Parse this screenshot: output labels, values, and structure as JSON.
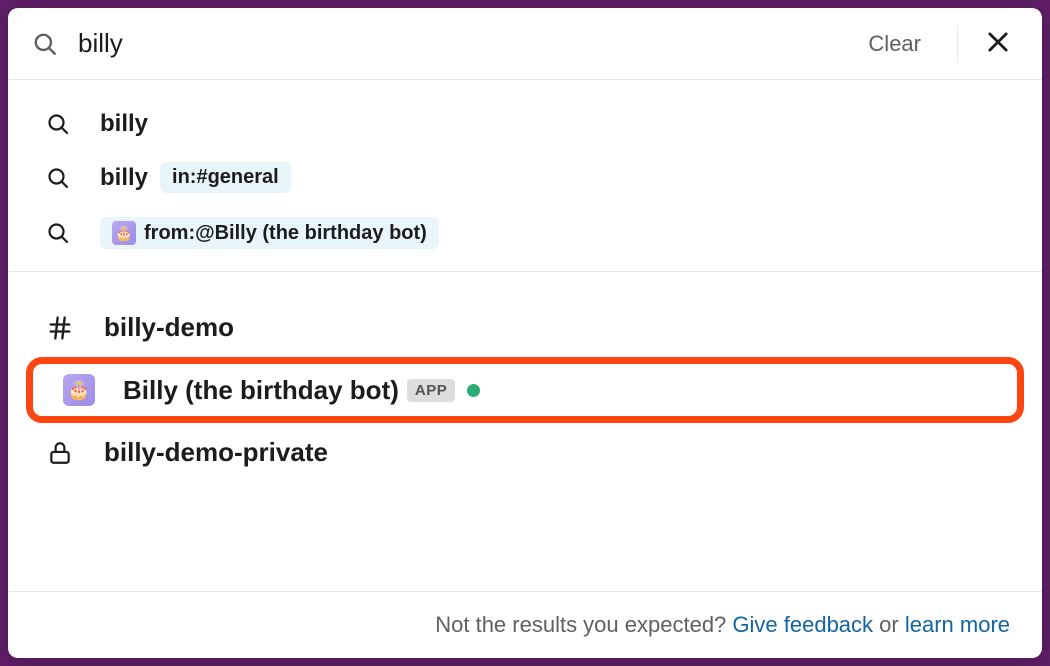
{
  "search": {
    "query": "billy",
    "clear_label": "Clear"
  },
  "suggestions": [
    {
      "type": "query",
      "text": "billy"
    },
    {
      "type": "scoped",
      "text": "billy",
      "chip": "in:#general"
    },
    {
      "type": "from",
      "chip": "from:@Billy (the birthday bot)"
    }
  ],
  "results": [
    {
      "type": "channel",
      "name": "billy-demo"
    },
    {
      "type": "app",
      "name": "Billy (the birthday bot)",
      "badge": "APP",
      "presence": "active",
      "highlighted": true
    },
    {
      "type": "private-channel",
      "name": "billy-demo-private"
    }
  ],
  "footer": {
    "prompt": "Not the results you expected? ",
    "feedback_link": "Give feedback",
    "or": " or ",
    "learn_link": "learn more"
  }
}
